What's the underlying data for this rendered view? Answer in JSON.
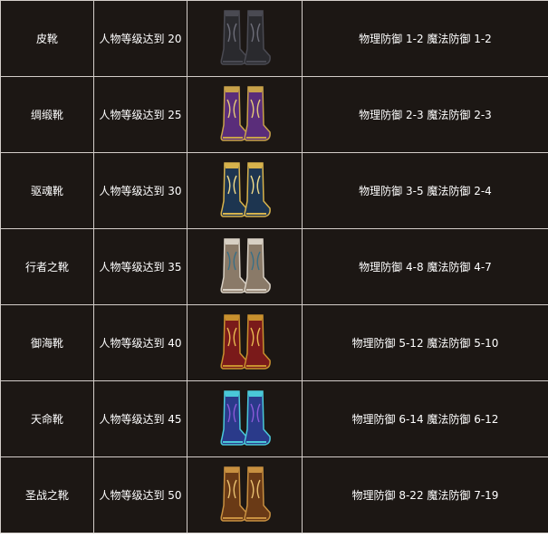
{
  "items": [
    {
      "name": "皮靴",
      "requirement": "人物等级达到 20",
      "stats": "物理防御 1-2  魔法防御  1-2",
      "image": "leather-boots-icon",
      "colors": {
        "main": "#2a2a2e",
        "trim": "#4a4a52",
        "accent": "#6d6d78"
      }
    },
    {
      "name": "绸缎靴",
      "requirement": "人物等级达到 25",
      "stats": "物理防御 2-3  魔法防御  2-3",
      "image": "silk-boots-icon",
      "colors": {
        "main": "#5a2d7a",
        "trim": "#c8a24a",
        "accent": "#e3c878"
      }
    },
    {
      "name": "驱魂靴",
      "requirement": "人物等级达到 30",
      "stats": "物理防御 3-5  魔法防御  2-4",
      "image": "soul-boots-icon",
      "colors": {
        "main": "#1d3550",
        "trim": "#d6b24c",
        "accent": "#f2dc8a"
      }
    },
    {
      "name": "行者之靴",
      "requirement": "人物等级达到 35",
      "stats": "物理防御 4-8  魔法防御  4-7",
      "image": "walker-boots-icon",
      "colors": {
        "main": "#8a7a68",
        "trim": "#d8d0c4",
        "accent": "#3a6f86"
      }
    },
    {
      "name": "御海靴",
      "requirement": "人物等级达到 40",
      "stats": "物理防御 5-12  魔法防御  5-10",
      "image": "sea-boots-icon",
      "colors": {
        "main": "#7a1a1a",
        "trim": "#c8902e",
        "accent": "#e8b850"
      }
    },
    {
      "name": "天命靴",
      "requirement": "人物等级达到 45",
      "stats": "物理防御 6-14  魔法防御  6-12",
      "image": "destiny-boots-icon",
      "colors": {
        "main": "#2a3a8a",
        "trim": "#4ac8d8",
        "accent": "#8a5ad8"
      }
    },
    {
      "name": "圣战之靴",
      "requirement": "人物等级达到 50",
      "stats": "物理防御 8-22  魔法防御  7-19",
      "image": "crusade-boots-icon",
      "colors": {
        "main": "#6a3a16",
        "trim": "#c89040",
        "accent": "#e8c070"
      }
    }
  ]
}
